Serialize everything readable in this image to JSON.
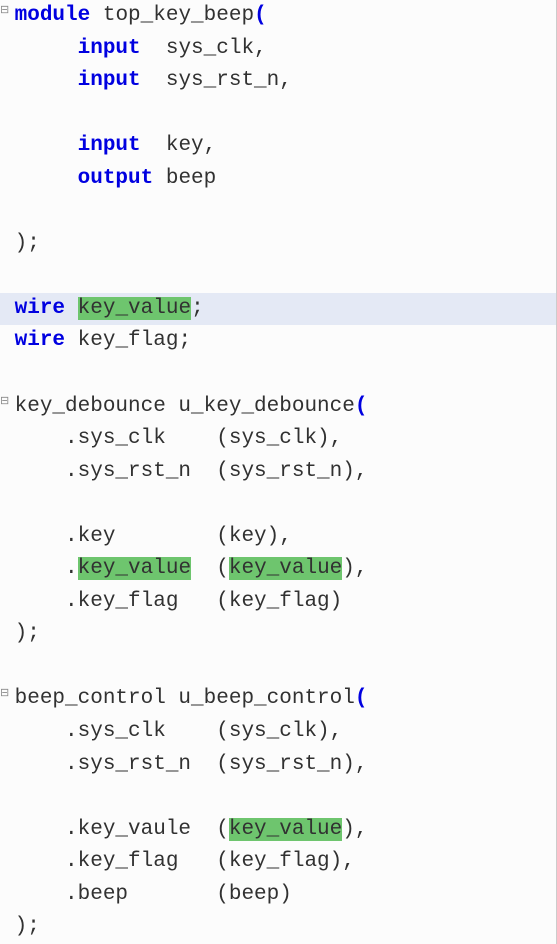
{
  "lines": {
    "l1_module": "module",
    "l1_name": " top_key_beep",
    "l1_paren": "(",
    "l2_kw": "input",
    "l2_txt": "  sys_clk,",
    "l3_kw": "input",
    "l3_txt": "  sys_rst_n,",
    "l5_kw": "input",
    "l5_txt": "  key,",
    "l6_kw": "output",
    "l6_txt": " beep",
    "l8_txt": ");",
    "l10_kw": "wire",
    "l10_sp": " ",
    "l10_hl": "key_value",
    "l10_semi": ";",
    "l11_kw": "wire",
    "l11_txt": " key_flag;",
    "l13_txt_a": "key_debounce u_key_debounce",
    "l13_paren": "(",
    "l14_txt": "     .sys_clk    (sys_clk),",
    "l15_txt": "     .sys_rst_n  (sys_rst_n),",
    "l17_txt": "     .key        (key),",
    "l18_a": "     .",
    "l18_hl1": "key_value",
    "l18_b": "  (",
    "l18_hl2": "key_value",
    "l18_c": "),",
    "l19_txt": "     .key_flag   (key_flag)",
    "l20_txt": ");",
    "l22_txt_a": "beep_control u_beep_control",
    "l22_paren": "(",
    "l23_txt": "     .sys_clk    (sys_clk),",
    "l24_txt": "     .sys_rst_n  (sys_rst_n),",
    "l26_a": "     .key_vaule  (",
    "l26_hl": "key_value",
    "l26_b": "),",
    "l27_txt": "     .key_flag   (key_flag),",
    "l28_txt": "     .beep       (beep)",
    "l29_txt": ");"
  }
}
